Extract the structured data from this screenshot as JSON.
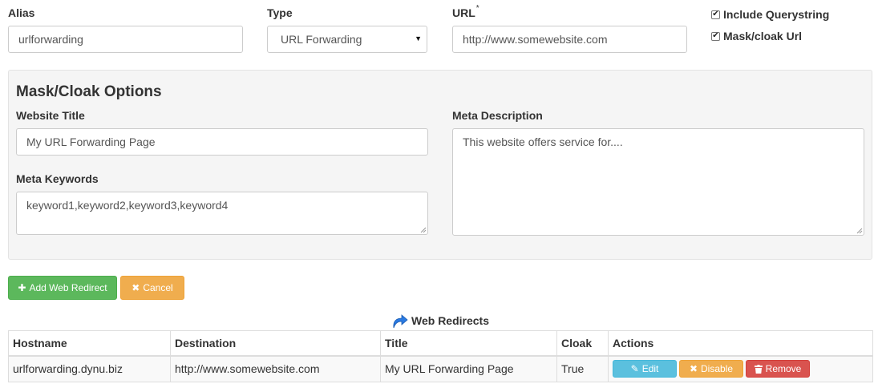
{
  "form": {
    "alias": {
      "label": "Alias",
      "value": "urlforwarding"
    },
    "type": {
      "label": "Type",
      "value": "URL Forwarding"
    },
    "url": {
      "label": "URL",
      "required_mark": "*",
      "placeholder": "http://www.somewebsite.com"
    },
    "include_querystring": {
      "label": "Include Querystring",
      "checked": true
    },
    "mask_cloak": {
      "label": "Mask/cloak Url",
      "checked": true
    }
  },
  "mask_options": {
    "heading": "Mask/Cloak Options",
    "website_title": {
      "label": "Website Title",
      "value": "My URL Forwarding Page"
    },
    "meta_keywords": {
      "label": "Meta Keywords",
      "value": "keyword1,keyword2,keyword3,keyword4"
    },
    "meta_description": {
      "label": "Meta Description",
      "placeholder": "This website offers service for...."
    }
  },
  "buttons": {
    "add": "Add Web Redirect",
    "cancel": "Cancel"
  },
  "redirects": {
    "title": "Web Redirects",
    "columns": [
      "Hostname",
      "Destination",
      "Title",
      "Cloak",
      "Actions"
    ],
    "rows": [
      {
        "hostname": "urlforwarding.dynu.biz",
        "destination": "http://www.somewebsite.com",
        "title": "My URL Forwarding Page",
        "cloak": "True",
        "actions": {
          "edit": "Edit",
          "disable": "Disable",
          "remove": "Remove"
        }
      }
    ]
  },
  "icons": {
    "plus": "plus-icon",
    "times": "times-icon",
    "pencil": "pencil-icon",
    "trash": "trash-icon",
    "redirect": "redirect-arrow-icon"
  },
  "colors": {
    "success": "#5cb85c",
    "warning": "#f0ad4e",
    "info": "#5bc0de",
    "danger": "#d9534f",
    "panel_bg": "#f5f5f5",
    "redirect_icon": "#2a7ae2"
  }
}
